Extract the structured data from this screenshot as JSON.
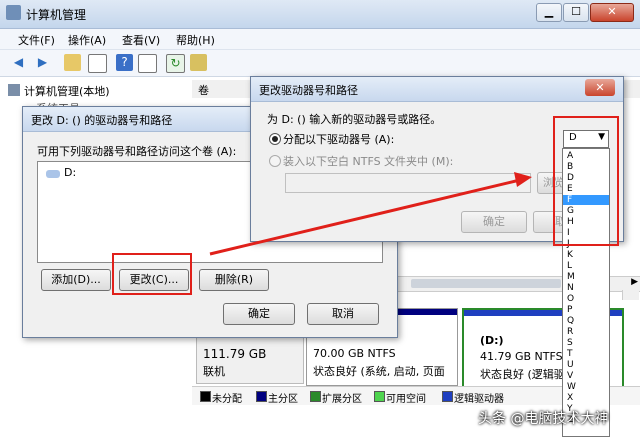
{
  "window": {
    "title": "计算机管理",
    "min_icon": "minimize-icon",
    "max_icon": "maximize-icon",
    "close_icon": "close-icon"
  },
  "menu": [
    "文件(F)",
    "操作(A)",
    "查看(V)",
    "帮助(H)"
  ],
  "tree": {
    "root": "计算机管理(本地)",
    "child_partial": "系统工具"
  },
  "grid": {
    "col_header_partial": "卷"
  },
  "disks": {
    "disk0": {
      "size": "111.79 GB",
      "status": "联机"
    },
    "vol_c": {
      "size": "70.00 GB NTFS",
      "status": "状态良好 (系统, 启动, 页面"
    },
    "vol_d": {
      "label": "(D:)",
      "size": "41.79 GB NTFS",
      "status": "状态良好 (逻辑驱动"
    }
  },
  "legend": [
    "未分配",
    "主分区",
    "扩展分区",
    "可用空间",
    "逻辑驱动器"
  ],
  "colors": {
    "accent_red": "#e0201a",
    "primary_partition": "#00007f",
    "logical_drive": "#1f3fc0",
    "extended": "#2a8a2a",
    "free": "#4ed44e",
    "unalloc": "#000000"
  },
  "dialog1": {
    "title": "更改 D: () 的驱动器号和路径",
    "instruction": "可用下列驱动器号和路径访问这个卷 (A):",
    "list_item": "D:",
    "add": "添加(D)...",
    "change": "更改(C)...",
    "delete": "删除(R)",
    "ok": "确定",
    "cancel": "取消"
  },
  "dialog2": {
    "title": "更改驱动器号和路径",
    "prompt": "为 D: () 输入新的驱动器号或路径。",
    "opt_assign": "分配以下驱动器号 (A):",
    "opt_mount": "装入以下空白 NTFS 文件夹中 (M):",
    "browse": "浏览",
    "ok": "确定",
    "cancel": "取消",
    "selected_letter": "D"
  },
  "dropdown": {
    "selected": "F",
    "items": [
      "A",
      "B",
      "D",
      "E",
      "F",
      "G",
      "H",
      "I",
      "J",
      "K",
      "L",
      "M",
      "N",
      "O",
      "P",
      "Q",
      "R",
      "S",
      "T",
      "U",
      "V",
      "W",
      "X",
      "Y",
      "Z"
    ]
  },
  "watermark": "头条 @电脑技术大神"
}
